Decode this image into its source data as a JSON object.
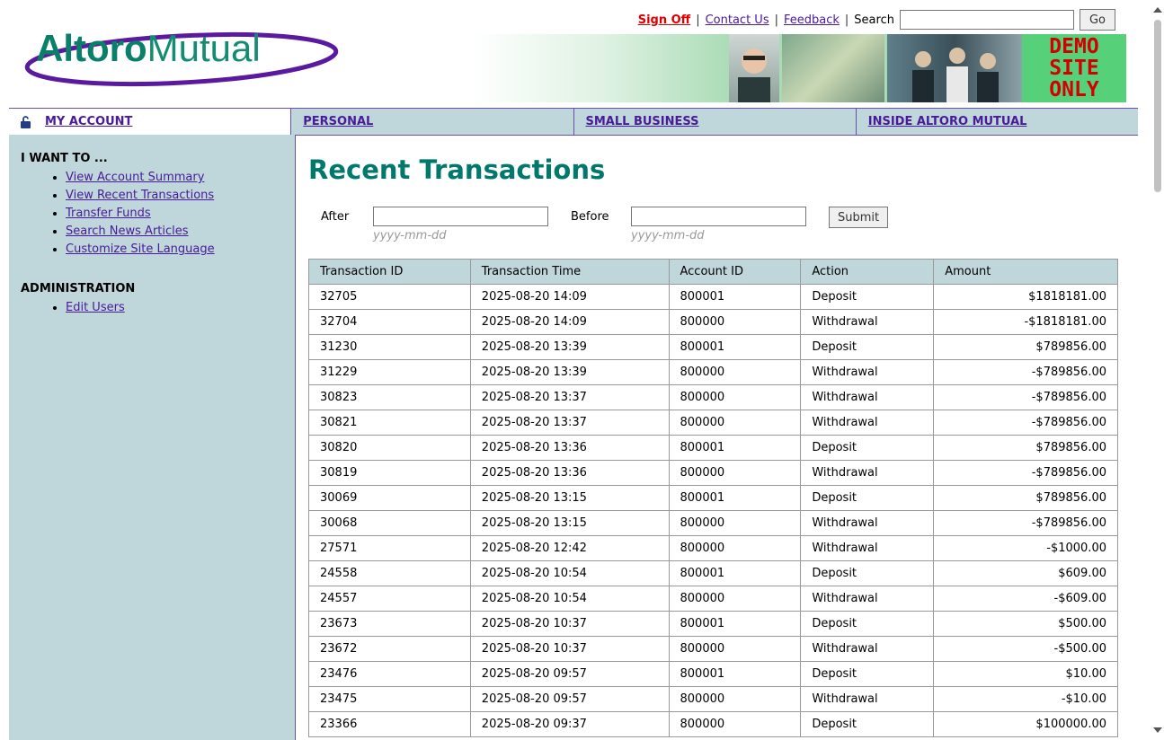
{
  "header": {
    "sign_off": "Sign Off",
    "contact_us": "Contact Us",
    "feedback": "Feedback",
    "search_label": "Search",
    "search_value": "",
    "go": "Go",
    "logo_text_1": "Altoro",
    "logo_text_2": "Mutual",
    "demo_lines": [
      "DEMO",
      "SITE",
      "ONLY"
    ]
  },
  "tabs": [
    "MY ACCOUNT",
    "PERSONAL",
    "SMALL BUSINESS",
    "INSIDE ALTORO MUTUAL"
  ],
  "sidebar": {
    "section1_title": "I WANT TO ...",
    "section1_links": [
      "View Account Summary",
      "View Recent Transactions",
      "Transfer Funds",
      "Search News Articles",
      "Customize Site Language"
    ],
    "section2_title": "ADMINISTRATION",
    "section2_links": [
      "Edit Users"
    ]
  },
  "main": {
    "title": "Recent Transactions",
    "after_label": "After",
    "before_label": "Before",
    "after_value": "",
    "before_value": "",
    "date_hint": "yyyy-mm-dd",
    "submit": "Submit",
    "columns": [
      "Transaction ID",
      "Transaction Time",
      "Account ID",
      "Action",
      "Amount"
    ],
    "rows": [
      [
        "32705",
        "2025-08-20 14:09",
        "800001",
        "Deposit",
        "$1818181.00"
      ],
      [
        "32704",
        "2025-08-20 14:09",
        "800000",
        "Withdrawal",
        "-$1818181.00"
      ],
      [
        "31230",
        "2025-08-20 13:39",
        "800001",
        "Deposit",
        "$789856.00"
      ],
      [
        "31229",
        "2025-08-20 13:39",
        "800000",
        "Withdrawal",
        "-$789856.00"
      ],
      [
        "30823",
        "2025-08-20 13:37",
        "800000",
        "Withdrawal",
        "-$789856.00"
      ],
      [
        "30821",
        "2025-08-20 13:37",
        "800000",
        "Withdrawal",
        "-$789856.00"
      ],
      [
        "30820",
        "2025-08-20 13:36",
        "800001",
        "Deposit",
        "$789856.00"
      ],
      [
        "30819",
        "2025-08-20 13:36",
        "800000",
        "Withdrawal",
        "-$789856.00"
      ],
      [
        "30069",
        "2025-08-20 13:15",
        "800001",
        "Deposit",
        "$789856.00"
      ],
      [
        "30068",
        "2025-08-20 13:15",
        "800000",
        "Withdrawal",
        "-$789856.00"
      ],
      [
        "27571",
        "2025-08-20 12:42",
        "800000",
        "Withdrawal",
        "-$1000.00"
      ],
      [
        "24558",
        "2025-08-20 10:54",
        "800001",
        "Deposit",
        "$609.00"
      ],
      [
        "24557",
        "2025-08-20 10:54",
        "800000",
        "Withdrawal",
        "-$609.00"
      ],
      [
        "23673",
        "2025-08-20 10:37",
        "800001",
        "Deposit",
        "$500.00"
      ],
      [
        "23672",
        "2025-08-20 10:37",
        "800000",
        "Withdrawal",
        "-$500.00"
      ],
      [
        "23476",
        "2025-08-20 09:57",
        "800001",
        "Deposit",
        "$10.00"
      ],
      [
        "23475",
        "2025-08-20 09:57",
        "800000",
        "Withdrawal",
        "-$10.00"
      ],
      [
        "23366",
        "2025-08-20 09:37",
        "800000",
        "Deposit",
        "$100000.00"
      ]
    ]
  },
  "colors": {
    "title": "#00786c",
    "nav_bg": "#bfd6da",
    "border": "#6b4db0",
    "sign_off": "#e00000",
    "demo_bg": "#57d07a",
    "demo_text": "#d40000"
  }
}
